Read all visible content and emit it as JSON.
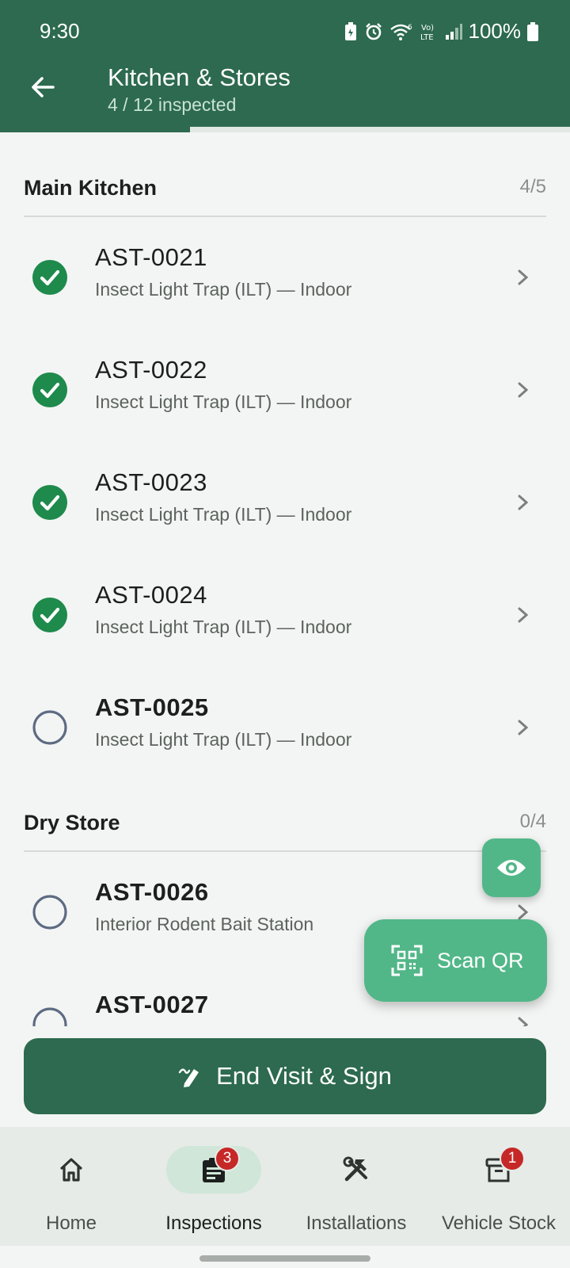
{
  "status_bar": {
    "time": "9:30",
    "battery": "100%"
  },
  "header": {
    "title": "Kitchen & Stores",
    "subtitle": "4 / 12 inspected",
    "progress": 0.333
  },
  "sections": [
    {
      "title": "Main Kitchen",
      "count": "4/5"
    },
    {
      "title": "Dry Store",
      "count": "0/4"
    }
  ],
  "assets": [
    {
      "code": "AST-0021",
      "type": "Insect Light Trap (ILT) — Indoor",
      "status": "done"
    },
    {
      "code": "AST-0022",
      "type": "Insect Light Trap (ILT) — Indoor",
      "status": "done"
    },
    {
      "code": "AST-0023",
      "type": "Insect Light Trap (ILT) — Indoor",
      "status": "done"
    },
    {
      "code": "AST-0024",
      "type": "Insect Light Trap (ILT) — Indoor",
      "status": "done"
    },
    {
      "code": "AST-0025",
      "type": "Insect Light Trap (ILT) — Indoor",
      "status": "pending"
    },
    {
      "code": "AST-0026",
      "type": "Interior Rodent Bait Station",
      "status": "pending"
    },
    {
      "code": "AST-0027",
      "type": "",
      "status": "pending"
    }
  ],
  "fab": {
    "scan_label": "Scan QR",
    "eye_icon": "eye-icon",
    "qr_icon": "qr-scan-icon"
  },
  "end_visit": {
    "label": "End Visit & Sign",
    "icon": "sign-pen-icon"
  },
  "nav": {
    "home": {
      "label": "Home",
      "icon": "home-icon"
    },
    "inspections": {
      "label": "Inspections",
      "icon": "clipboard-icon",
      "badge": "3"
    },
    "installations": {
      "label": "Installations",
      "icon": "tools-icon"
    },
    "vehicle_stock": {
      "label": "Vehicle Stock",
      "icon": "archive-box-icon",
      "badge": "1"
    }
  },
  "colors": {
    "primary": "#2d6a4f",
    "accent": "#52b788",
    "done": "#1e8a4c",
    "badge": "#c62828"
  }
}
